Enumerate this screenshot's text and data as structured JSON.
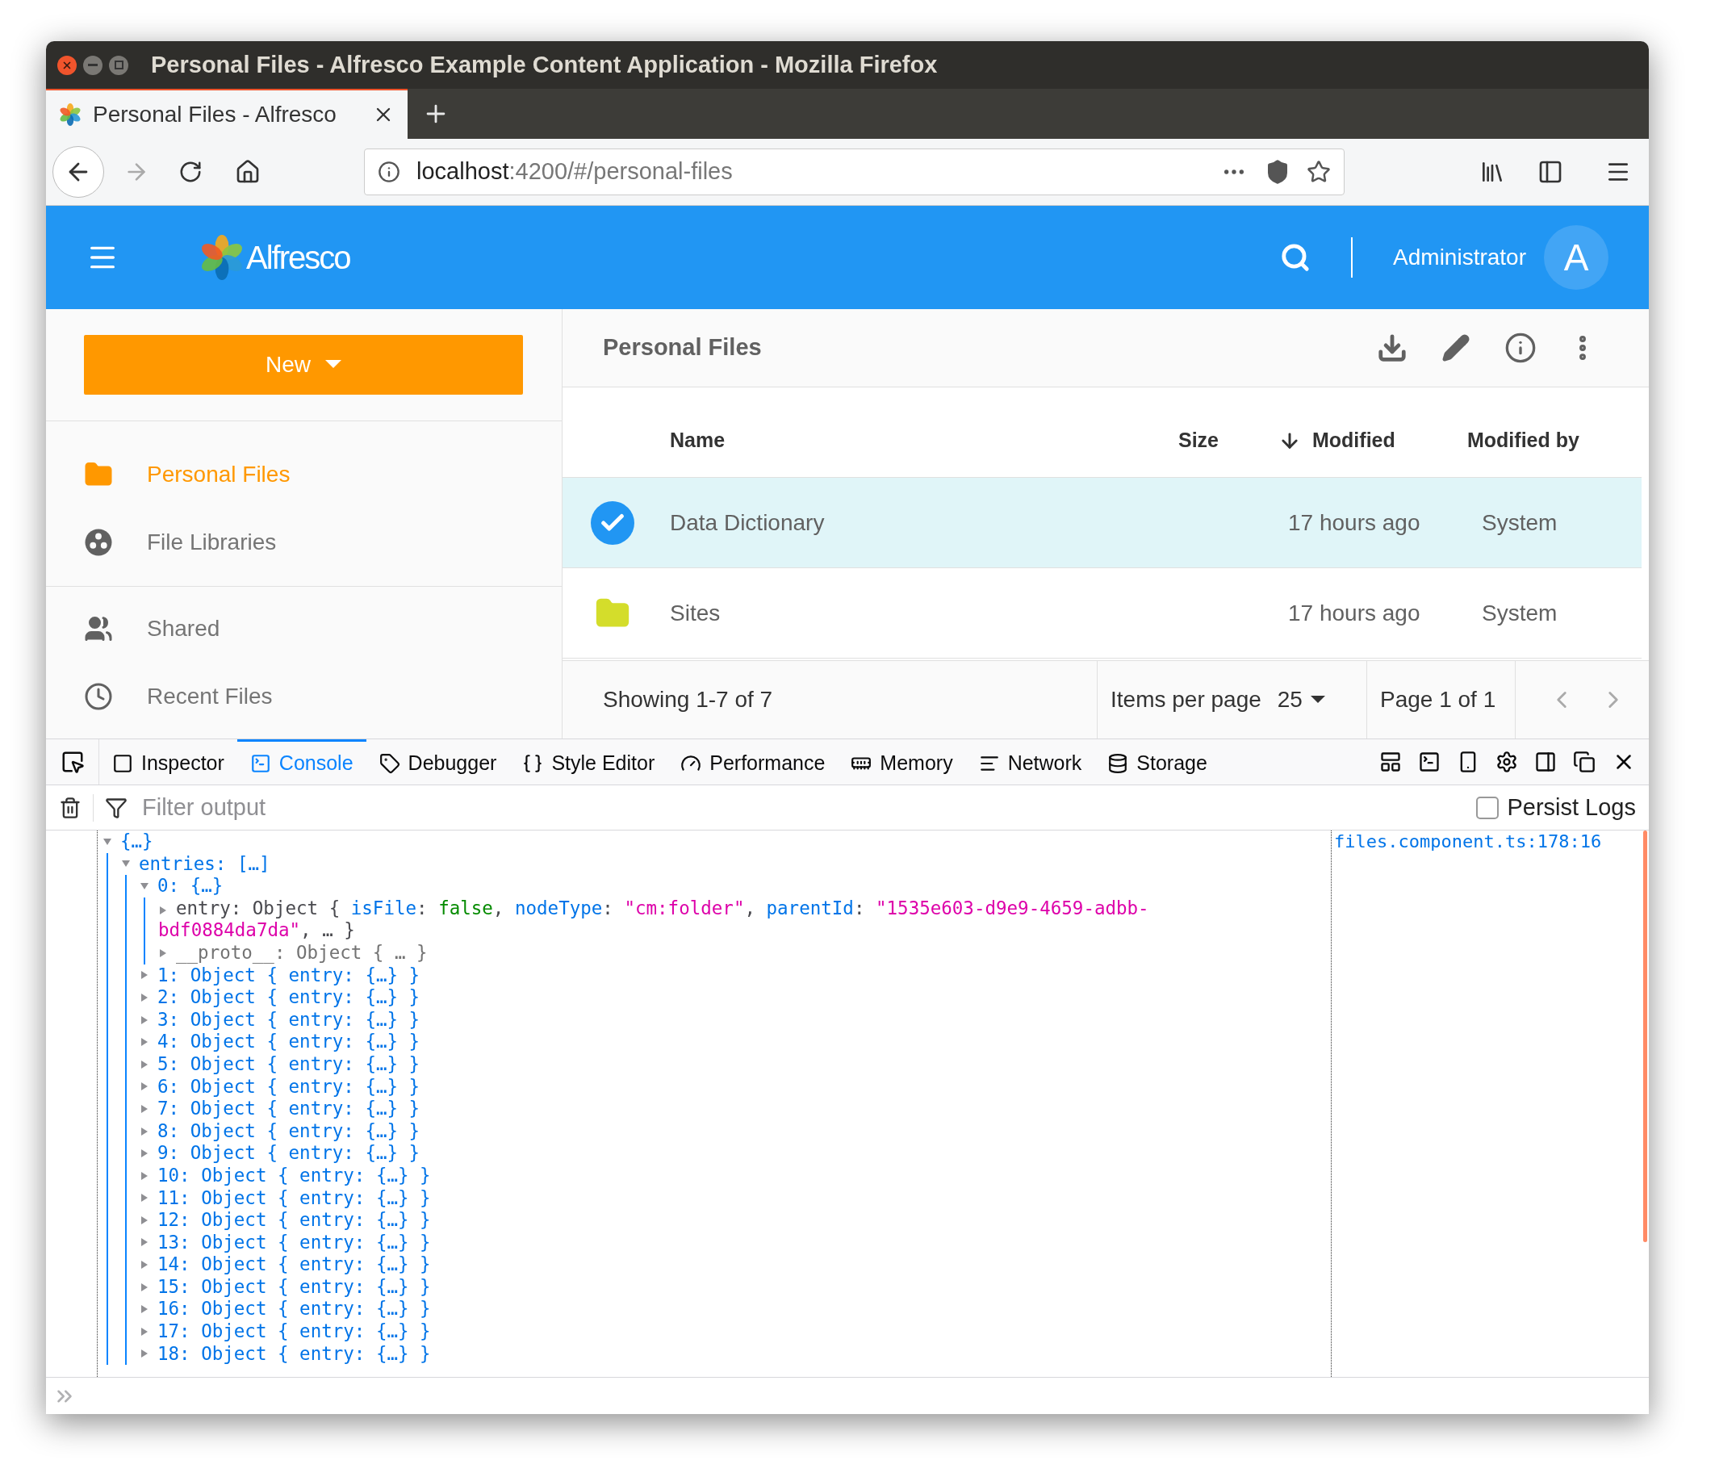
{
  "window": {
    "title": "Personal Files - Alfresco Example Content Application - Mozilla Firefox"
  },
  "browser_tabs": [
    {
      "label": "Personal Files - Alfresco",
      "selected": true
    }
  ],
  "address_bar": {
    "host": "localhost",
    "path": ":4200/#/personal-files"
  },
  "app_header": {
    "logo_text": "Alfresco",
    "user_name": "Administrator",
    "avatar_initial": "A"
  },
  "sidebar": {
    "new_button": "New",
    "items": [
      {
        "kind": "folder",
        "label": "Personal Files",
        "selected": true
      },
      {
        "kind": "libraries",
        "label": "File Libraries",
        "selected": false
      },
      {
        "kind": "shared",
        "label": "Shared",
        "selected": false
      },
      {
        "kind": "recent",
        "label": "Recent Files",
        "selected": false
      }
    ]
  },
  "content": {
    "title": "Personal Files",
    "columns": [
      "Name",
      "Size",
      "Modified",
      "Modified by"
    ],
    "rows": [
      {
        "name": "Data Dictionary",
        "modified": "17 hours ago",
        "modified_by": "System",
        "selected": true
      },
      {
        "name": "Sites",
        "modified": "17 hours ago",
        "modified_by": "System",
        "selected": false
      }
    ],
    "pagination": {
      "showing": "Showing 1-7 of 7",
      "items_per_page_label": "Items per page",
      "items_per_page": "25",
      "page": "Page 1 of 1"
    }
  },
  "devtools": {
    "tabs": [
      {
        "label": "Inspector",
        "selected": false
      },
      {
        "label": "Console",
        "selected": true
      },
      {
        "label": "Debugger",
        "selected": false
      },
      {
        "label": "Style Editor",
        "selected": false
      },
      {
        "label": "Performance",
        "selected": false
      },
      {
        "label": "Memory",
        "selected": false
      },
      {
        "label": "Network",
        "selected": false
      },
      {
        "label": "Storage",
        "selected": false
      }
    ],
    "filter": {
      "placeholder": "Filter output"
    },
    "persist_logs": {
      "label": "Persist Logs",
      "checked": false
    },
    "source_link": "files.component.ts:178:16",
    "console_tree": [
      {
        "kind": "object",
        "text": "{…}",
        "expanded": true,
        "children": [
          {
            "kind": "object",
            "text": "entries: […]",
            "expanded": true,
            "children": [
              {
                "kind": "object",
                "text": "0: {…}",
                "expanded": true,
                "children": [
                  {
                    "kind": "entry",
                    "expanded": false,
                    "segments": [
                      {
                        "kind": "plain",
                        "text": "entry: Object { "
                      },
                      {
                        "kind": "key",
                        "text": "isFile"
                      },
                      {
                        "kind": "plain",
                        "text": ": "
                      },
                      {
                        "kind": "bool",
                        "text": "false"
                      },
                      {
                        "kind": "plain",
                        "text": ", "
                      },
                      {
                        "kind": "key",
                        "text": "nodeType"
                      },
                      {
                        "kind": "plain",
                        "text": ": "
                      },
                      {
                        "kind": "string",
                        "text": "\"cm:folder\""
                      },
                      {
                        "kind": "plain",
                        "text": ", "
                      },
                      {
                        "kind": "key",
                        "text": "parentId"
                      },
                      {
                        "kind": "plain",
                        "text": ": "
                      },
                      {
                        "kind": "string",
                        "text": "\"1535e603-d9e9-4659-adbb-bdf0884da7da\""
                      },
                      {
                        "kind": "plain",
                        "text": ", … }"
                      }
                    ]
                  },
                  {
                    "kind": "proto",
                    "text": "__proto__: Object { … }",
                    "expanded": false
                  }
                ]
              },
              {
                "kind": "object",
                "text": "1: Object { entry: {…} }",
                "expanded": false
              },
              {
                "kind": "object",
                "text": "2: Object { entry: {…} }",
                "expanded": false
              },
              {
                "kind": "object",
                "text": "3: Object { entry: {…} }",
                "expanded": false
              },
              {
                "kind": "object",
                "text": "4: Object { entry: {…} }",
                "expanded": false
              },
              {
                "kind": "object",
                "text": "5: Object { entry: {…} }",
                "expanded": false
              },
              {
                "kind": "object",
                "text": "6: Object { entry: {…} }",
                "expanded": false
              },
              {
                "kind": "object",
                "text": "7: Object { entry: {…} }",
                "expanded": false
              },
              {
                "kind": "object",
                "text": "8: Object { entry: {…} }",
                "expanded": false
              },
              {
                "kind": "object",
                "text": "9: Object { entry: {…} }",
                "expanded": false
              },
              {
                "kind": "object",
                "text": "10: Object { entry: {…} }",
                "expanded": false
              },
              {
                "kind": "object",
                "text": "11: Object { entry: {…} }",
                "expanded": false
              },
              {
                "kind": "object",
                "text": "12: Object { entry: {…} }",
                "expanded": false
              },
              {
                "kind": "object",
                "text": "13: Object { entry: {…} }",
                "expanded": false
              },
              {
                "kind": "object",
                "text": "14: Object { entry: {…} }",
                "expanded": false
              },
              {
                "kind": "object",
                "text": "15: Object { entry: {…} }",
                "expanded": false
              },
              {
                "kind": "object",
                "text": "16: Object { entry: {…} }",
                "expanded": false
              },
              {
                "kind": "object",
                "text": "17: Object { entry: {…} }",
                "expanded": false
              },
              {
                "kind": "object",
                "text": "18: Object { entry: {…} }",
                "expanded": false
              }
            ]
          }
        ]
      }
    ]
  }
}
